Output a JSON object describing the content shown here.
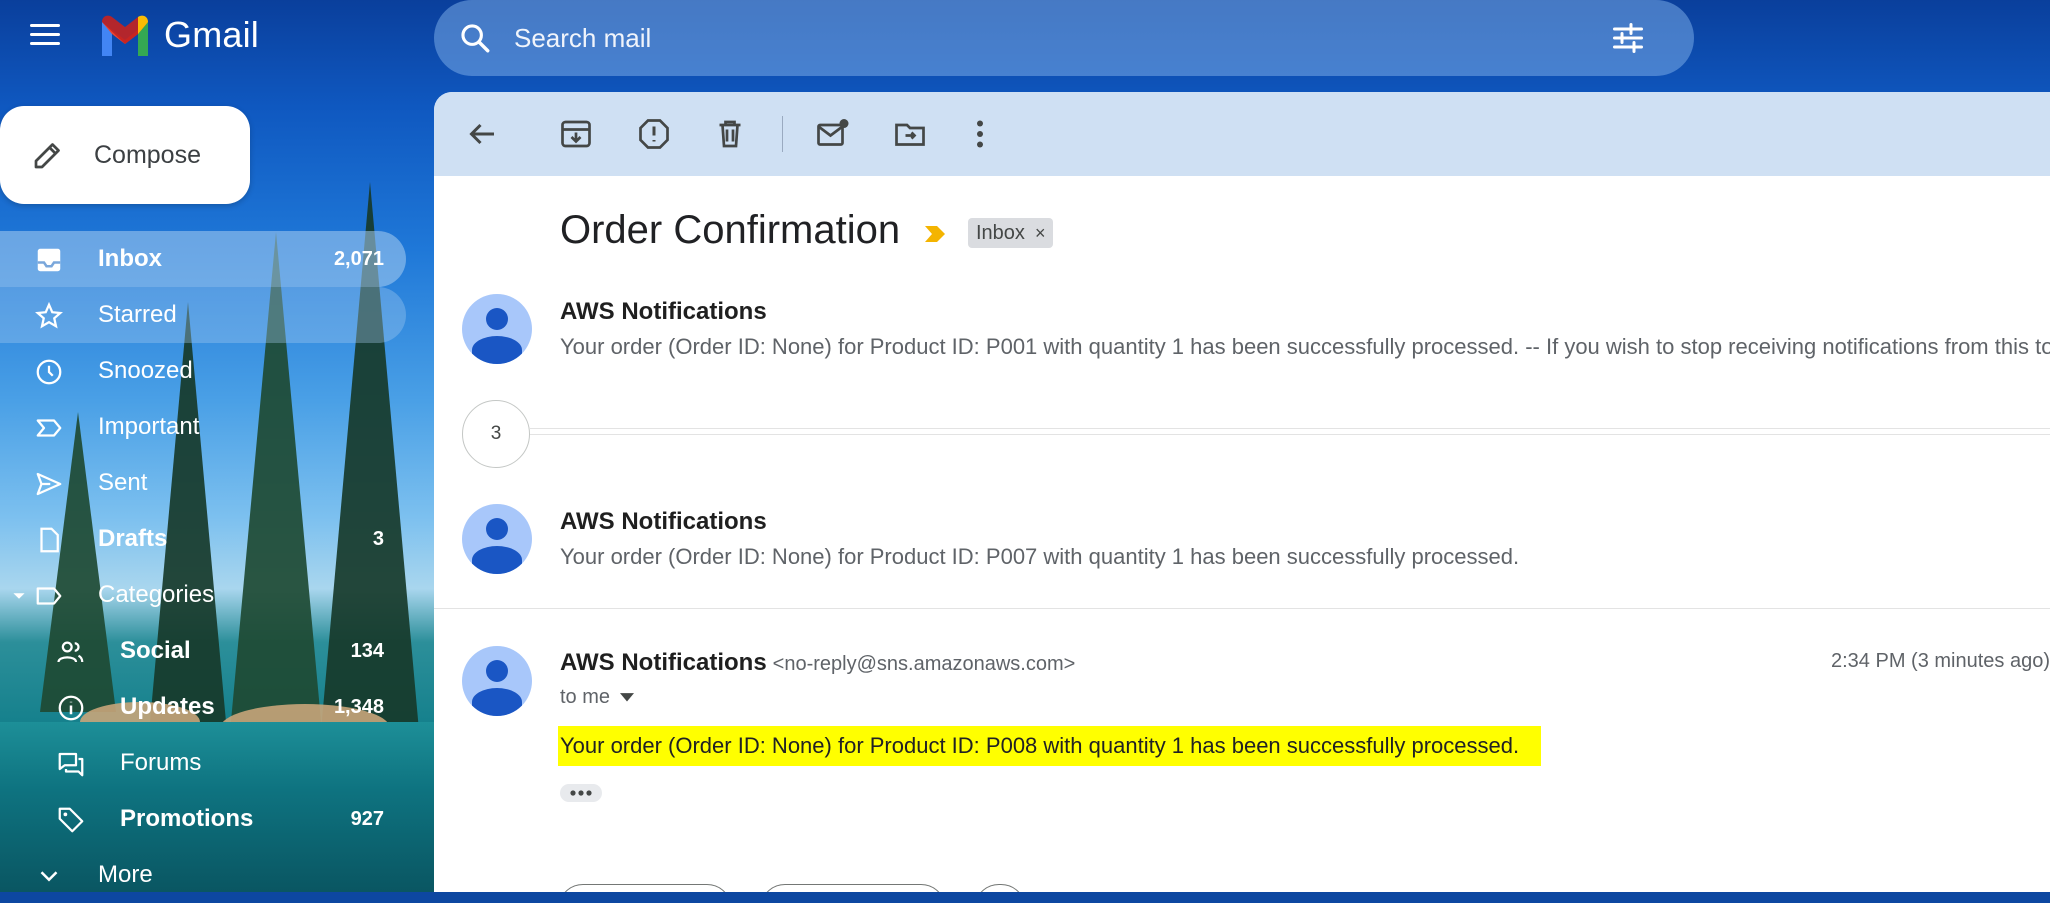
{
  "app": {
    "name": "Gmail"
  },
  "search": {
    "placeholder": "Search mail"
  },
  "compose": {
    "label": "Compose"
  },
  "nav": [
    {
      "key": "inbox",
      "label": "Inbox",
      "count": "2,071",
      "icon": "inbox-icon",
      "bold": true,
      "active": true
    },
    {
      "key": "starred",
      "label": "Starred",
      "count": "",
      "icon": "star-icon"
    },
    {
      "key": "snoozed",
      "label": "Snoozed",
      "count": "",
      "icon": "clock-icon"
    },
    {
      "key": "important",
      "label": "Important",
      "count": "",
      "icon": "important-icon"
    },
    {
      "key": "sent",
      "label": "Sent",
      "count": "",
      "icon": "send-icon"
    },
    {
      "key": "drafts",
      "label": "Drafts",
      "count": "3",
      "icon": "draft-icon",
      "bold": true
    },
    {
      "key": "categories",
      "label": "Categories",
      "count": "",
      "icon": "label-icon"
    },
    {
      "key": "social",
      "label": "Social",
      "count": "134",
      "icon": "people-icon",
      "bold": true,
      "sub": true
    },
    {
      "key": "updates",
      "label": "Updates",
      "count": "1,348",
      "icon": "info-icon",
      "bold": true,
      "sub": true
    },
    {
      "key": "forums",
      "label": "Forums",
      "count": "",
      "icon": "forum-icon",
      "sub": true
    },
    {
      "key": "promotions",
      "label": "Promotions",
      "count": "927",
      "icon": "tag-icon",
      "bold": true,
      "sub": true
    },
    {
      "key": "more",
      "label": "More",
      "count": "",
      "icon": "chevron-down-icon"
    }
  ],
  "thread": {
    "subject": "Order Confirmation",
    "label_chip": "Inbox",
    "chip_close": "×",
    "collapsed_count": "3",
    "messages": [
      {
        "sender": "AWS Notifications",
        "snippet": "Your order (Order ID: None) for Product ID: P001 with quantity 1 has been successfully processed. -- If you wish to stop receiving notifications from this topic, please click or visit the link below to unsubscribe"
      },
      {
        "sender": "AWS Notifications",
        "snippet": "Your order (Order ID: None) for Product ID: P007 with quantity 1 has been successfully processed."
      },
      {
        "sender": "AWS Notifications",
        "email": "<no-reply@sns.amazonaws.com>",
        "time": "2:34 PM (3 minutes ago)",
        "to": "to me",
        "body": "Your order (Order ID: None) for Product ID: P008 with quantity 1 has been successfully processed."
      }
    ]
  },
  "colors": {
    "highlight": "#ffff00",
    "accent": "#0b57d0"
  }
}
